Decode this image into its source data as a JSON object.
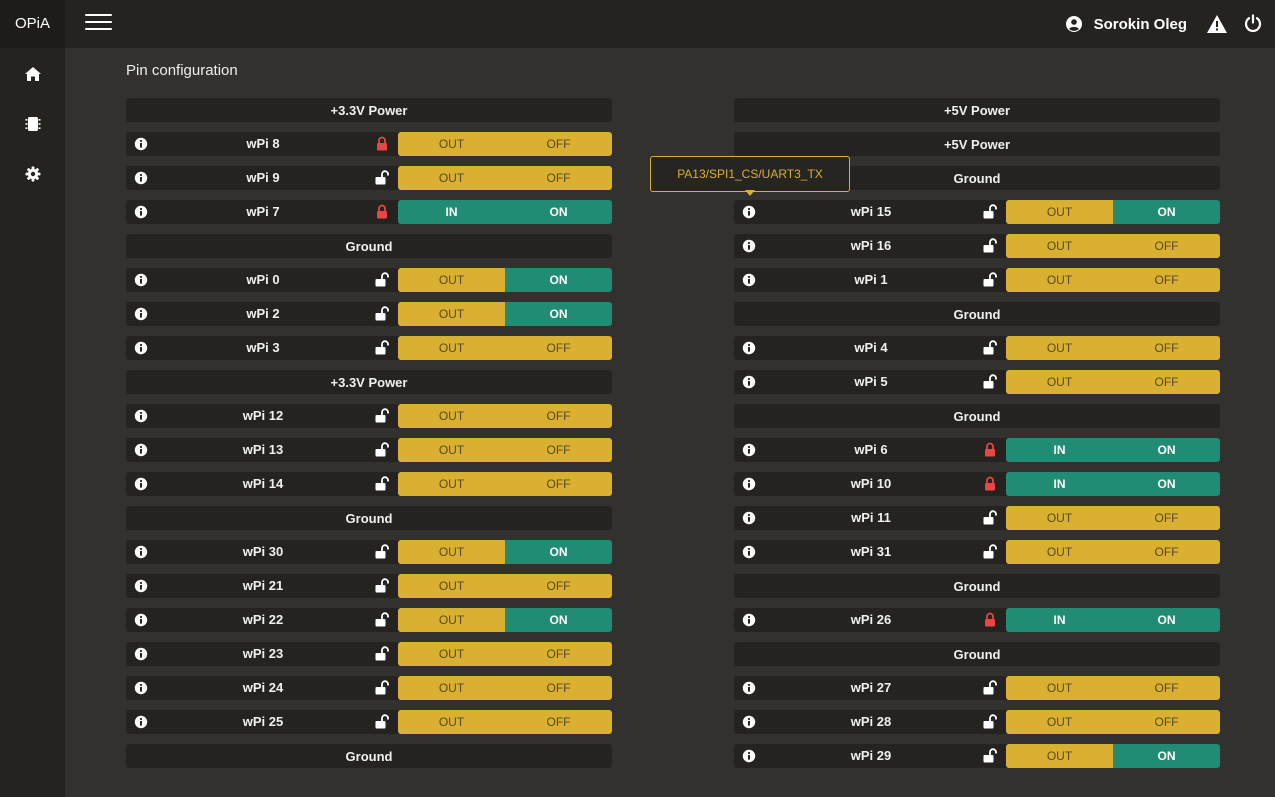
{
  "header": {
    "brand": "OPiA",
    "user_name": "Sorokin Oleg"
  },
  "sidebar": {
    "items": [
      {
        "icon": "home-icon"
      },
      {
        "icon": "chip-icon"
      },
      {
        "icon": "gear-icon"
      }
    ]
  },
  "main": {
    "title": "Pin configuration"
  },
  "tooltip": {
    "text": "PA13/SPI1_CS/UART3_TX"
  },
  "colors": {
    "yellow": "#d9b032",
    "green": "#218c74",
    "lock_red": "#e84545",
    "background": "#32312d",
    "row_dark": "#24231f"
  },
  "pins_left": [
    {
      "kind": "power",
      "label": "+3.3V Power"
    },
    {
      "kind": "gpio",
      "name": "wPi 8",
      "locked": true,
      "mode": "OUT",
      "state": "OFF"
    },
    {
      "kind": "gpio",
      "name": "wPi 9",
      "locked": false,
      "mode": "OUT",
      "state": "OFF"
    },
    {
      "kind": "gpio",
      "name": "wPi 7",
      "locked": true,
      "mode": "IN",
      "state": "ON"
    },
    {
      "kind": "power",
      "label": "Ground"
    },
    {
      "kind": "gpio",
      "name": "wPi 0",
      "locked": false,
      "mode": "OUT",
      "state": "ON"
    },
    {
      "kind": "gpio",
      "name": "wPi 2",
      "locked": false,
      "mode": "OUT",
      "state": "ON"
    },
    {
      "kind": "gpio",
      "name": "wPi 3",
      "locked": false,
      "mode": "OUT",
      "state": "OFF"
    },
    {
      "kind": "power",
      "label": "+3.3V Power"
    },
    {
      "kind": "gpio",
      "name": "wPi 12",
      "locked": false,
      "mode": "OUT",
      "state": "OFF"
    },
    {
      "kind": "gpio",
      "name": "wPi 13",
      "locked": false,
      "mode": "OUT",
      "state": "OFF"
    },
    {
      "kind": "gpio",
      "name": "wPi 14",
      "locked": false,
      "mode": "OUT",
      "state": "OFF"
    },
    {
      "kind": "power",
      "label": "Ground"
    },
    {
      "kind": "gpio",
      "name": "wPi 30",
      "locked": false,
      "mode": "OUT",
      "state": "ON"
    },
    {
      "kind": "gpio",
      "name": "wPi 21",
      "locked": false,
      "mode": "OUT",
      "state": "OFF"
    },
    {
      "kind": "gpio",
      "name": "wPi 22",
      "locked": false,
      "mode": "OUT",
      "state": "ON"
    },
    {
      "kind": "gpio",
      "name": "wPi 23",
      "locked": false,
      "mode": "OUT",
      "state": "OFF"
    },
    {
      "kind": "gpio",
      "name": "wPi 24",
      "locked": false,
      "mode": "OUT",
      "state": "OFF"
    },
    {
      "kind": "gpio",
      "name": "wPi 25",
      "locked": false,
      "mode": "OUT",
      "state": "OFF"
    },
    {
      "kind": "power",
      "label": "Ground"
    }
  ],
  "pins_right": [
    {
      "kind": "power",
      "label": "+5V Power"
    },
    {
      "kind": "power",
      "label": "+5V Power"
    },
    {
      "kind": "power",
      "label": "Ground"
    },
    {
      "kind": "gpio",
      "name": "wPi 15",
      "locked": false,
      "mode": "OUT",
      "state": "ON"
    },
    {
      "kind": "gpio",
      "name": "wPi 16",
      "locked": false,
      "mode": "OUT",
      "state": "OFF"
    },
    {
      "kind": "gpio",
      "name": "wPi 1",
      "locked": false,
      "mode": "OUT",
      "state": "OFF"
    },
    {
      "kind": "power",
      "label": "Ground"
    },
    {
      "kind": "gpio",
      "name": "wPi 4",
      "locked": false,
      "mode": "OUT",
      "state": "OFF"
    },
    {
      "kind": "gpio",
      "name": "wPi 5",
      "locked": false,
      "mode": "OUT",
      "state": "OFF"
    },
    {
      "kind": "power",
      "label": "Ground"
    },
    {
      "kind": "gpio",
      "name": "wPi 6",
      "locked": true,
      "mode": "IN",
      "state": "ON"
    },
    {
      "kind": "gpio",
      "name": "wPi 10",
      "locked": true,
      "mode": "IN",
      "state": "ON"
    },
    {
      "kind": "gpio",
      "name": "wPi 11",
      "locked": false,
      "mode": "OUT",
      "state": "OFF"
    },
    {
      "kind": "gpio",
      "name": "wPi 31",
      "locked": false,
      "mode": "OUT",
      "state": "OFF"
    },
    {
      "kind": "power",
      "label": "Ground"
    },
    {
      "kind": "gpio",
      "name": "wPi 26",
      "locked": true,
      "mode": "IN",
      "state": "ON"
    },
    {
      "kind": "power",
      "label": "Ground"
    },
    {
      "kind": "gpio",
      "name": "wPi 27",
      "locked": false,
      "mode": "OUT",
      "state": "OFF"
    },
    {
      "kind": "gpio",
      "name": "wPi 28",
      "locked": false,
      "mode": "OUT",
      "state": "OFF"
    },
    {
      "kind": "gpio",
      "name": "wPi 29",
      "locked": false,
      "mode": "OUT",
      "state": "ON"
    }
  ]
}
